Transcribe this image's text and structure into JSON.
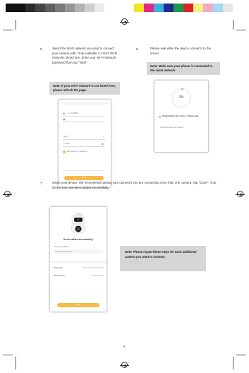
{
  "colors": {
    "bar_left": [
      "#111111",
      "#111111",
      "#2b2b2b",
      "#444444",
      "#5f5f5f",
      "#7a7a7a",
      "#979797",
      "#b3b3b3",
      "#cfcfcf",
      "#eaeaea",
      "#ffffff"
    ],
    "bar_right": [
      "#f3e32a",
      "#e12a86",
      "#3aaee0",
      "#1f2b8c",
      "#1a9a4a",
      "#d8242b",
      "#f5ef83",
      "#f2a9c9",
      "#a9d8f1",
      "#e6e6e6"
    ],
    "note_bg": "#d6d6d6",
    "accent": "#f6b94a"
  },
  "step5": {
    "number": "5.",
    "text": "Select the Wi-Fi network you want to connect your camera with. Only available 2.4 GHz Wi-Fi networks show here. Enter your Wi-Fi Network password then tap \"Next\".",
    "note": "Note: If your Wi-Fi network is not listed here, please refresh the page.",
    "phone": {
      "field1": "1-Unit 3888",
      "field2": "5GHz",
      "field3": "2.4GHz",
      "checkbox": "Remember my password",
      "button": "Next"
    }
  },
  "step6": {
    "number": "6.",
    "text": "Please wait while the device connects to the server.",
    "note": "Note: Make sure your phone is connected to the same network.",
    "phone": {
      "progress": "3%",
      "status": "Connecting to the server... Please wait.",
      "hint": "Link disconnects via network"
    }
  },
  "step7": {
    "number": "7.",
    "text": "Name your device. We recommend naming your camera if you are connecting more than one camera. Tap \"Done\". Your device has now been added successfully.",
    "note": "Note: Please repeat these steps for each additional camera you want to connect.",
    "phone": {
      "title": "Device added successfully!",
      "name_label": "Name your device",
      "name_value": "Set the camera name",
      "row1_label": "Time Zone",
      "row2_label": "Date Format",
      "button": "Done"
    }
  },
  "page_number": "8"
}
